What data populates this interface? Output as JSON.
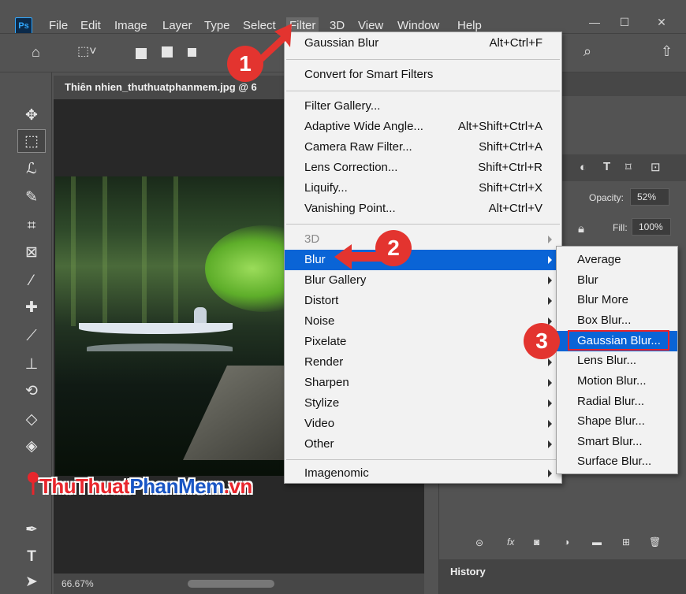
{
  "app": {
    "logo": "Ps",
    "menus": [
      "File",
      "Edit",
      "Image",
      "Layer",
      "Type",
      "Select",
      "Filter",
      "3D",
      "View",
      "Window",
      "Help"
    ],
    "window_controls": [
      "—",
      "☐",
      "✕"
    ]
  },
  "document": {
    "tab_title": "Thiên nhien_thuthuatphanmem.jpg @ 6",
    "zoom": "66.67%",
    "watermark_part1": "ThuThuat",
    "watermark_part2": "PhanMem",
    "watermark_part3": ".vn"
  },
  "layers_panel": {
    "opacity_label": "Opacity:",
    "opacity_value": "52%",
    "fill_label": "Fill:",
    "fill_value": "100%"
  },
  "history_panel": {
    "title": "History"
  },
  "filter_menu": {
    "top_items": [
      {
        "label": "Gaussian Blur",
        "shortcut": "Alt+Ctrl+F"
      },
      {
        "label": "Convert for Smart Filters",
        "shortcut": ""
      },
      {
        "label": "Filter Gallery...",
        "shortcut": ""
      },
      {
        "label": "Adaptive Wide Angle...",
        "shortcut": "Alt+Shift+Ctrl+A"
      },
      {
        "label": "Camera Raw Filter...",
        "shortcut": "Shift+Ctrl+A"
      },
      {
        "label": "Lens Correction...",
        "shortcut": "Shift+Ctrl+R"
      },
      {
        "label": "Liquify...",
        "shortcut": "Shift+Ctrl+X"
      },
      {
        "label": "Vanishing Point...",
        "shortcut": "Alt+Ctrl+V"
      }
    ],
    "submenus": [
      "3D",
      "Blur",
      "Blur Gallery",
      "Distort",
      "Noise",
      "Pixelate",
      "Render",
      "Sharpen",
      "Stylize",
      "Video",
      "Other"
    ],
    "plugins": [
      "Imagenomic"
    ],
    "highlighted": "Blur"
  },
  "blur_submenu": {
    "items": [
      "Average",
      "Blur",
      "Blur More",
      "Box Blur...",
      "Gaussian Blur...",
      "Lens Blur...",
      "Motion Blur...",
      "Radial Blur...",
      "Shape Blur...",
      "Smart Blur...",
      "Surface Blur..."
    ],
    "highlighted": "Gaussian Blur..."
  },
  "steps": [
    "1",
    "2",
    "3"
  ],
  "colors": {
    "accent_highlight": "#0a64d6",
    "annotation_red": "#e3342f",
    "ui_dark": "#535353"
  }
}
